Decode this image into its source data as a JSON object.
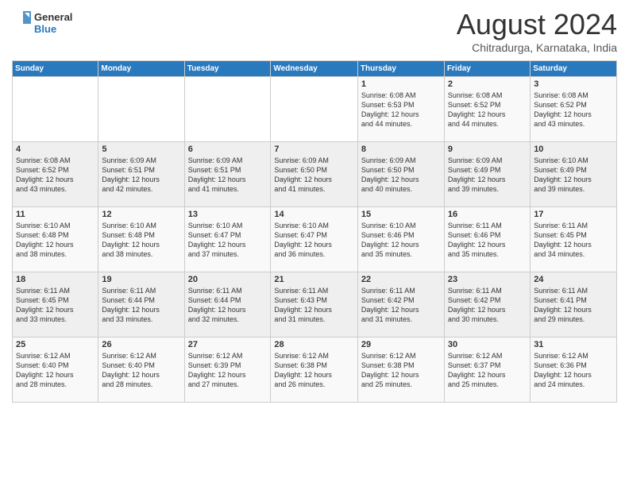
{
  "header": {
    "logo_text_top": "General",
    "logo_text_bottom": "Blue",
    "month_title": "August 2024",
    "subtitle": "Chitradurga, Karnataka, India"
  },
  "calendar": {
    "weekdays": [
      "Sunday",
      "Monday",
      "Tuesday",
      "Wednesday",
      "Thursday",
      "Friday",
      "Saturday"
    ],
    "weeks": [
      [
        {
          "day": "",
          "info": ""
        },
        {
          "day": "",
          "info": ""
        },
        {
          "day": "",
          "info": ""
        },
        {
          "day": "",
          "info": ""
        },
        {
          "day": "1",
          "info": "Sunrise: 6:08 AM\nSunset: 6:53 PM\nDaylight: 12 hours\nand 44 minutes."
        },
        {
          "day": "2",
          "info": "Sunrise: 6:08 AM\nSunset: 6:52 PM\nDaylight: 12 hours\nand 44 minutes."
        },
        {
          "day": "3",
          "info": "Sunrise: 6:08 AM\nSunset: 6:52 PM\nDaylight: 12 hours\nand 43 minutes."
        }
      ],
      [
        {
          "day": "4",
          "info": "Sunrise: 6:08 AM\nSunset: 6:52 PM\nDaylight: 12 hours\nand 43 minutes."
        },
        {
          "day": "5",
          "info": "Sunrise: 6:09 AM\nSunset: 6:51 PM\nDaylight: 12 hours\nand 42 minutes."
        },
        {
          "day": "6",
          "info": "Sunrise: 6:09 AM\nSunset: 6:51 PM\nDaylight: 12 hours\nand 41 minutes."
        },
        {
          "day": "7",
          "info": "Sunrise: 6:09 AM\nSunset: 6:50 PM\nDaylight: 12 hours\nand 41 minutes."
        },
        {
          "day": "8",
          "info": "Sunrise: 6:09 AM\nSunset: 6:50 PM\nDaylight: 12 hours\nand 40 minutes."
        },
        {
          "day": "9",
          "info": "Sunrise: 6:09 AM\nSunset: 6:49 PM\nDaylight: 12 hours\nand 39 minutes."
        },
        {
          "day": "10",
          "info": "Sunrise: 6:10 AM\nSunset: 6:49 PM\nDaylight: 12 hours\nand 39 minutes."
        }
      ],
      [
        {
          "day": "11",
          "info": "Sunrise: 6:10 AM\nSunset: 6:48 PM\nDaylight: 12 hours\nand 38 minutes."
        },
        {
          "day": "12",
          "info": "Sunrise: 6:10 AM\nSunset: 6:48 PM\nDaylight: 12 hours\nand 38 minutes."
        },
        {
          "day": "13",
          "info": "Sunrise: 6:10 AM\nSunset: 6:47 PM\nDaylight: 12 hours\nand 37 minutes."
        },
        {
          "day": "14",
          "info": "Sunrise: 6:10 AM\nSunset: 6:47 PM\nDaylight: 12 hours\nand 36 minutes."
        },
        {
          "day": "15",
          "info": "Sunrise: 6:10 AM\nSunset: 6:46 PM\nDaylight: 12 hours\nand 35 minutes."
        },
        {
          "day": "16",
          "info": "Sunrise: 6:11 AM\nSunset: 6:46 PM\nDaylight: 12 hours\nand 35 minutes."
        },
        {
          "day": "17",
          "info": "Sunrise: 6:11 AM\nSunset: 6:45 PM\nDaylight: 12 hours\nand 34 minutes."
        }
      ],
      [
        {
          "day": "18",
          "info": "Sunrise: 6:11 AM\nSunset: 6:45 PM\nDaylight: 12 hours\nand 33 minutes."
        },
        {
          "day": "19",
          "info": "Sunrise: 6:11 AM\nSunset: 6:44 PM\nDaylight: 12 hours\nand 33 minutes."
        },
        {
          "day": "20",
          "info": "Sunrise: 6:11 AM\nSunset: 6:44 PM\nDaylight: 12 hours\nand 32 minutes."
        },
        {
          "day": "21",
          "info": "Sunrise: 6:11 AM\nSunset: 6:43 PM\nDaylight: 12 hours\nand 31 minutes."
        },
        {
          "day": "22",
          "info": "Sunrise: 6:11 AM\nSunset: 6:42 PM\nDaylight: 12 hours\nand 31 minutes."
        },
        {
          "day": "23",
          "info": "Sunrise: 6:11 AM\nSunset: 6:42 PM\nDaylight: 12 hours\nand 30 minutes."
        },
        {
          "day": "24",
          "info": "Sunrise: 6:11 AM\nSunset: 6:41 PM\nDaylight: 12 hours\nand 29 minutes."
        }
      ],
      [
        {
          "day": "25",
          "info": "Sunrise: 6:12 AM\nSunset: 6:40 PM\nDaylight: 12 hours\nand 28 minutes."
        },
        {
          "day": "26",
          "info": "Sunrise: 6:12 AM\nSunset: 6:40 PM\nDaylight: 12 hours\nand 28 minutes."
        },
        {
          "day": "27",
          "info": "Sunrise: 6:12 AM\nSunset: 6:39 PM\nDaylight: 12 hours\nand 27 minutes."
        },
        {
          "day": "28",
          "info": "Sunrise: 6:12 AM\nSunset: 6:38 PM\nDaylight: 12 hours\nand 26 minutes."
        },
        {
          "day": "29",
          "info": "Sunrise: 6:12 AM\nSunset: 6:38 PM\nDaylight: 12 hours\nand 25 minutes."
        },
        {
          "day": "30",
          "info": "Sunrise: 6:12 AM\nSunset: 6:37 PM\nDaylight: 12 hours\nand 25 minutes."
        },
        {
          "day": "31",
          "info": "Sunrise: 6:12 AM\nSunset: 6:36 PM\nDaylight: 12 hours\nand 24 minutes."
        }
      ]
    ]
  }
}
